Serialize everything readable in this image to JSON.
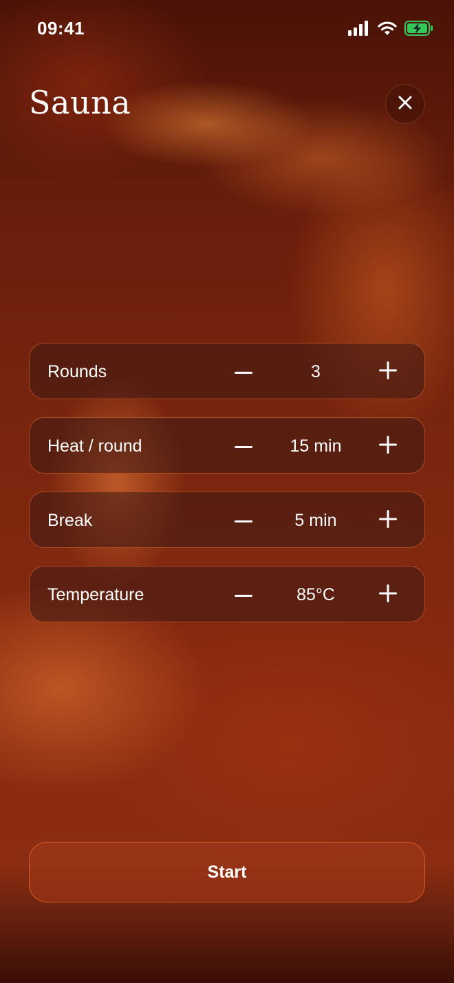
{
  "status_bar": {
    "time": "09:41",
    "icons": [
      "signal-icon",
      "wifi-icon",
      "battery-charging-icon"
    ],
    "battery_color": "#34c759"
  },
  "header": {
    "title": "Sauna",
    "close_icon": "close-icon"
  },
  "settings": [
    {
      "label": "Rounds",
      "value": "3"
    },
    {
      "label": "Heat / round",
      "value": "15 min"
    },
    {
      "label": "Break",
      "value": "5 min"
    },
    {
      "label": "Temperature",
      "value": "85°C"
    }
  ],
  "start_button": {
    "label": "Start"
  },
  "colors": {
    "accent": "#e8642a",
    "background_dark": "#4a1207",
    "background_mid": "#882a10"
  }
}
